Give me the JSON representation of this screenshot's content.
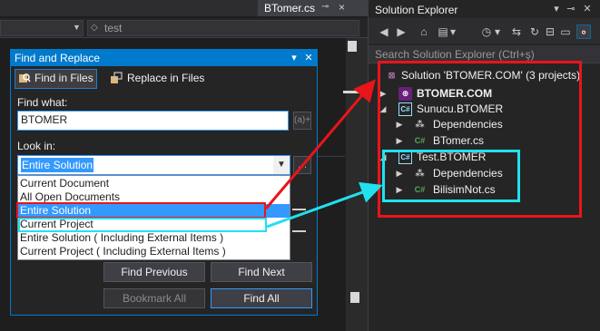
{
  "editor": {
    "tab_title": "BTomer.cs",
    "tab_pin_icon": "pin-icon",
    "tab_close": "×",
    "nav_text": "test"
  },
  "dialog": {
    "title": "Find and Replace",
    "tab_find_in_files": "Find in Files",
    "tab_replace_in_files": "Replace in Files",
    "find_what_label": "Find what:",
    "find_what_value": "BTOMER",
    "regex_button": "(a)+",
    "look_in_label": "Look in:",
    "look_in_value": "Entire Solution",
    "look_in_options": [
      "Current Document",
      "All Open Documents",
      "Entire Solution",
      "Current Project",
      "Entire Solution ( Including External Items )",
      "Current Project ( Including External Items )"
    ],
    "selected_option_index": 2,
    "find_previous": "Find Previous",
    "find_next": "Find Next",
    "bookmark_all": "Bookmark All",
    "find_all": "Find All"
  },
  "solution_explorer": {
    "title": "Solution Explorer",
    "search_placeholder": "Search Solution Explorer (Ctrl+ş)",
    "solution_label": "Solution 'BTOMER.COM' (3 projects)",
    "projects": [
      {
        "name": "BTOMER.COM",
        "bold": true,
        "type": "web"
      },
      {
        "name": "Sunucu.BTOMER",
        "type": "csproj",
        "children": [
          "Dependencies",
          "BTomer.cs"
        ]
      },
      {
        "name": "Test.BTOMER",
        "type": "csproj",
        "children": [
          "Dependencies",
          "BilisimNot.cs"
        ]
      }
    ]
  },
  "colors": {
    "accent": "#007acc",
    "highlight_red": "#e8151a",
    "highlight_cyan": "#21e1ef",
    "selection": "#3399ff"
  }
}
